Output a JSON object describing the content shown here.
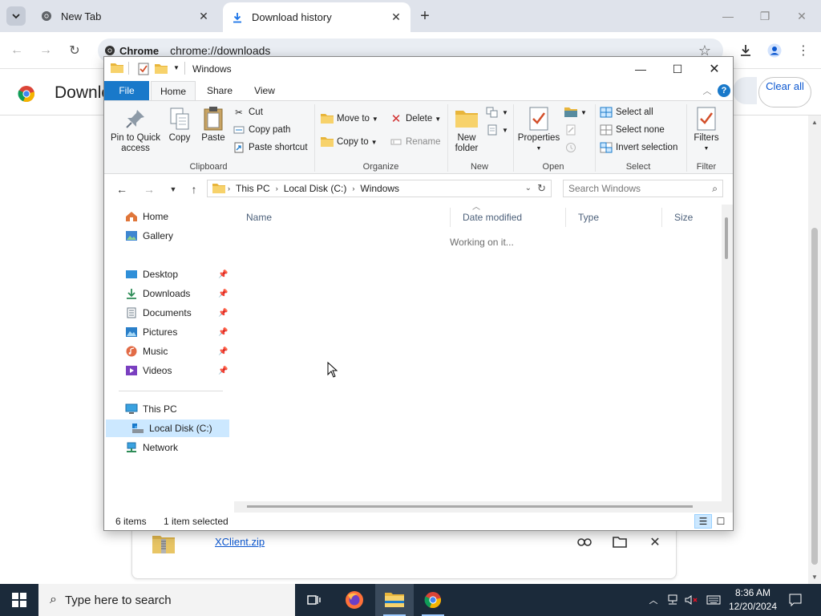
{
  "chrome": {
    "tabs": [
      {
        "label": "New Tab",
        "active": false
      },
      {
        "label": "Download history",
        "active": true
      }
    ],
    "omnibox": {
      "chip": "Chrome",
      "url": "chrome://downloads"
    },
    "downloads_title": "Downloads",
    "clear_all_label": "Clear all",
    "download_item": {
      "file_name": "XClient.zip"
    }
  },
  "explorer": {
    "title": "Windows",
    "ribbon_tabs": [
      "File",
      "Home",
      "Share",
      "View"
    ],
    "clipboard": {
      "pin_label": "Pin to Quick access",
      "copy_label": "Copy",
      "paste_label": "Paste",
      "cut_label": "Cut",
      "copy_path_label": "Copy path",
      "paste_shortcut_label": "Paste shortcut",
      "group_label": "Clipboard"
    },
    "organize": {
      "move_to_label": "Move to",
      "copy_to_label": "Copy to",
      "delete_label": "Delete",
      "rename_label": "Rename",
      "group_label": "Organize"
    },
    "new": {
      "new_folder_label": "New folder",
      "group_label": "New"
    },
    "open": {
      "properties_label": "Properties",
      "group_label": "Open"
    },
    "select": {
      "select_all_label": "Select all",
      "select_none_label": "Select none",
      "invert_label": "Invert selection",
      "group_label": "Select"
    },
    "filter": {
      "filters_label": "Filters",
      "group_label": "Filter"
    },
    "address": {
      "segments": [
        "This PC",
        "Local Disk (C:)",
        "Windows"
      ],
      "search_placeholder": "Search Windows"
    },
    "nav": {
      "home": "Home",
      "gallery": "Gallery",
      "desktop": "Desktop",
      "downloads": "Downloads",
      "documents": "Documents",
      "pictures": "Pictures",
      "music": "Music",
      "videos": "Videos",
      "this_pc": "This PC",
      "local_disk": "Local Disk (C:)",
      "network": "Network"
    },
    "columns": [
      "Name",
      "Date modified",
      "Type",
      "Size"
    ],
    "working_text": "Working on it...",
    "status": {
      "items": "6 items",
      "selected": "1 item selected"
    }
  },
  "taskbar": {
    "search_placeholder": "Type here to search",
    "time": "8:36 AM",
    "date": "12/20/2024"
  },
  "colors": {
    "accent": "#1979ca",
    "taskbar": "#1b2a3a",
    "selection": "#cce8ff",
    "link": "#0b57d0"
  }
}
